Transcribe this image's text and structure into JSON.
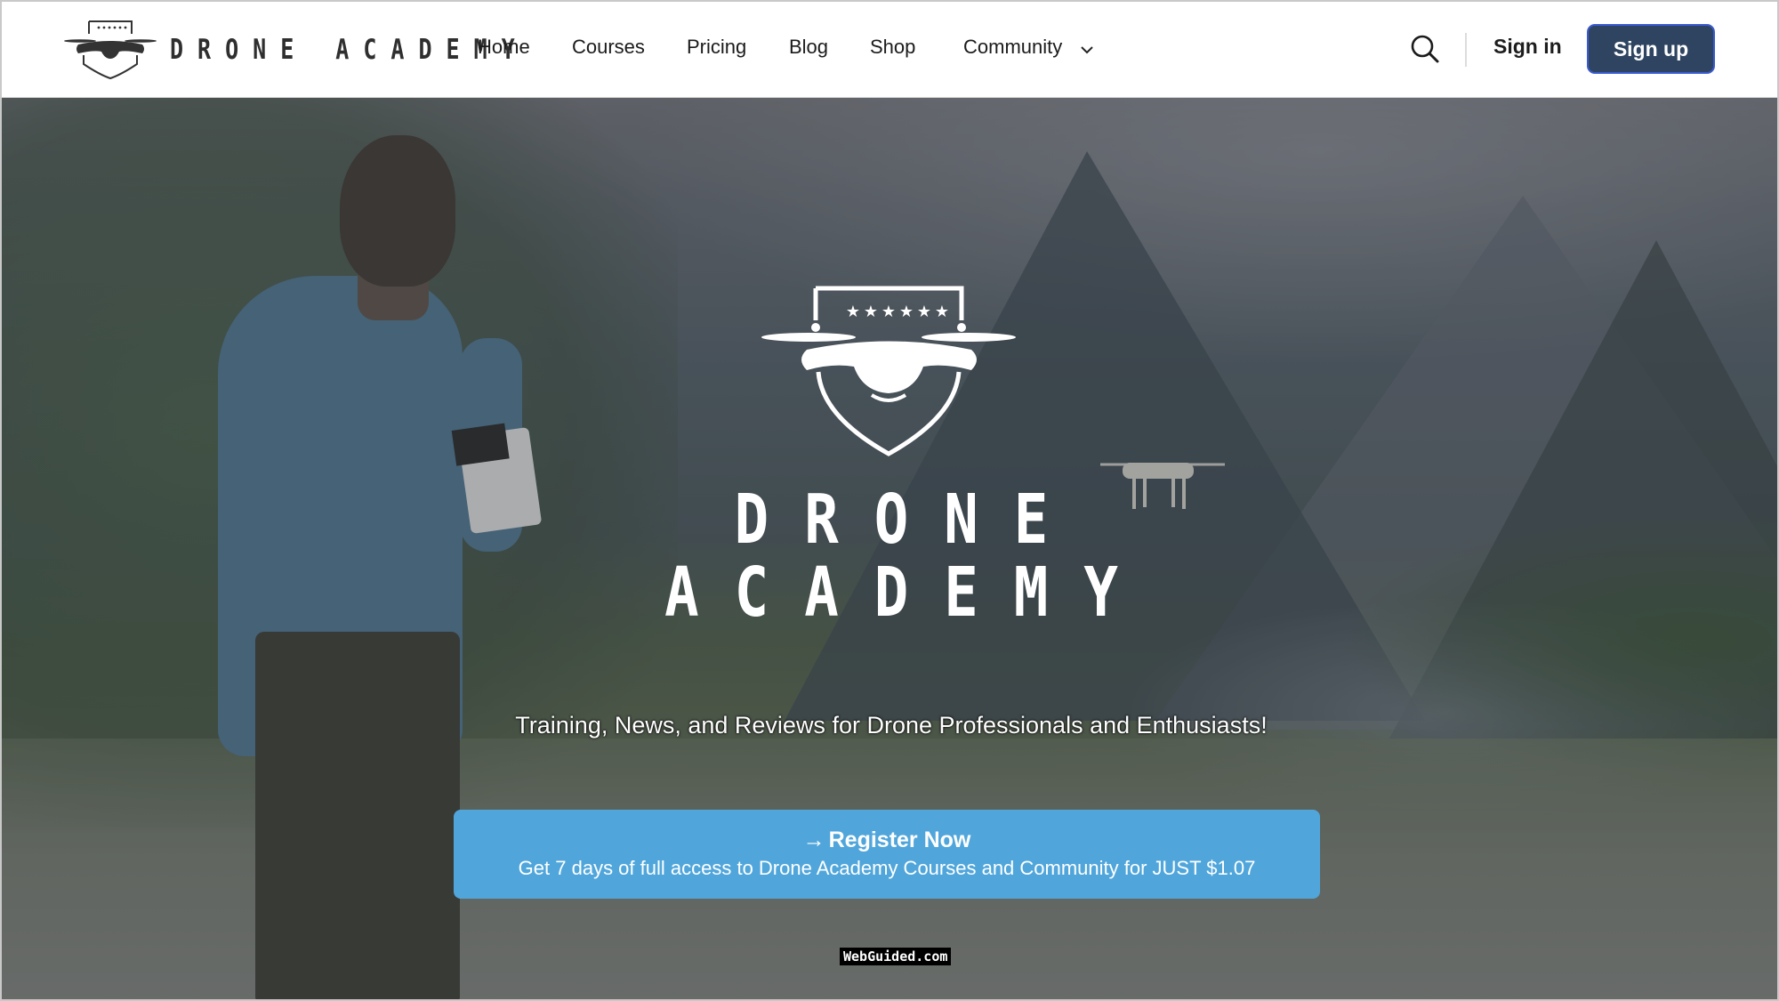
{
  "header": {
    "brand_name": "DRONE ACADEMY",
    "nav": [
      {
        "label": "Home"
      },
      {
        "label": "Courses"
      },
      {
        "label": "Pricing"
      },
      {
        "label": "Blog"
      },
      {
        "label": "Shop"
      },
      {
        "label": "Community",
        "has_dropdown": true
      }
    ],
    "search_icon": "search-icon",
    "signin_label": "Sign in",
    "signup_label": "Sign up"
  },
  "hero": {
    "logo_icon": "drone-shield-logo",
    "title_line1": "DRONE",
    "title_line2": "ACADEMY",
    "tagline": "Training, News, and Reviews for Drone Professionals and Enthusiasts!",
    "cta": {
      "arrow": "→",
      "title": "Register Now",
      "subtitle": "Get 7 days of full access to Drone Academy Courses and Community for JUST $1.07"
    }
  },
  "watermark": "WebGuided.com",
  "colors": {
    "signup_bg": "#2e4461",
    "cta_bg": "#50a6db",
    "header_bg": "#ffffff"
  }
}
